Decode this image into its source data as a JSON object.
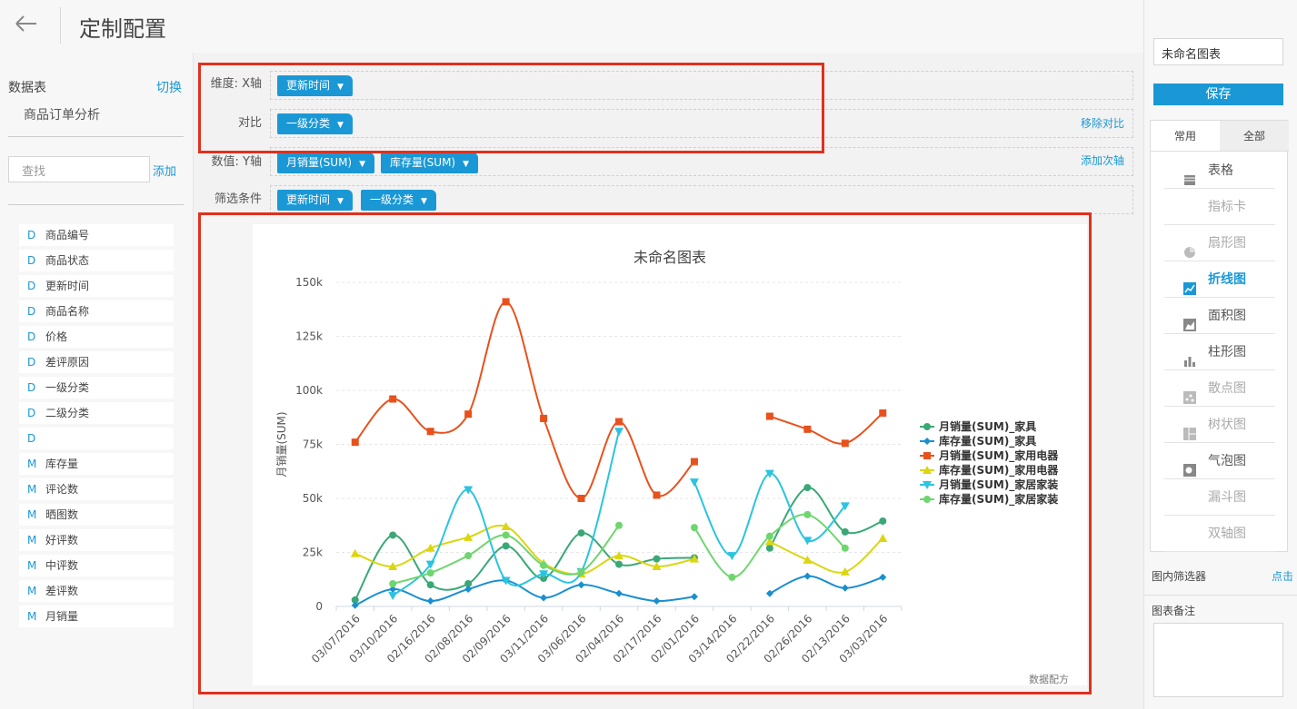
{
  "header": {
    "title": "定制配置",
    "back_icon": "arrow-left-icon"
  },
  "left": {
    "title": "数据表",
    "switch_label": "切换",
    "table_name": "商品订单分析",
    "search_placeholder": "查找",
    "add_label": "添加",
    "fields": [
      {
        "type": "D",
        "name": "商品编号"
      },
      {
        "type": "D",
        "name": "商品状态"
      },
      {
        "type": "D",
        "name": "更新时间"
      },
      {
        "type": "D",
        "name": "商品名称"
      },
      {
        "type": "D",
        "name": "价格"
      },
      {
        "type": "D",
        "name": "差评原因"
      },
      {
        "type": "D",
        "name": "一级分类"
      },
      {
        "type": "D",
        "name": "二级分类"
      },
      {
        "type": "D",
        "name": ""
      },
      {
        "type": "M",
        "name": "库存量"
      },
      {
        "type": "M",
        "name": "评论数"
      },
      {
        "type": "M",
        "name": "晒图数"
      },
      {
        "type": "M",
        "name": "好评数"
      },
      {
        "type": "M",
        "name": "中评数"
      },
      {
        "type": "M",
        "name": "差评数"
      },
      {
        "type": "M",
        "name": "月销量"
      }
    ]
  },
  "config": {
    "dimension_label": "维度: X轴",
    "dimension_chip": "更新时间",
    "compare_label": "对比",
    "compare_chip": "一级分类",
    "remove_compare": "移除对比",
    "value_label": "数值: Y轴",
    "value_chips": [
      "月销量(SUM)",
      "库存量(SUM)"
    ],
    "add_secondary_axis": "添加次轴",
    "filter_label": "筛选条件",
    "filter_chips": [
      "更新时间",
      "一级分类"
    ]
  },
  "chart_data": {
    "type": "line",
    "title": "未命名图表",
    "ylabel": "月销量(SUM)",
    "xlabel": "",
    "footer": "数据配方",
    "ylim": [
      0,
      150000
    ],
    "yticks": [
      0,
      25000,
      50000,
      75000,
      100000,
      125000,
      150000
    ],
    "ytick_labels": [
      "0",
      "25k",
      "50k",
      "75k",
      "100k",
      "125k",
      "150k"
    ],
    "categories": [
      "03/07/2016",
      "03/10/2016",
      "02/16/2016",
      "02/08/2016",
      "02/09/2016",
      "03/11/2016",
      "03/06/2016",
      "02/04/2016",
      "02/17/2016",
      "02/01/2016",
      "03/14/2016",
      "02/22/2016",
      "02/26/2016",
      "02/13/2016",
      "03/03/2016"
    ],
    "legend_position": "right",
    "series": [
      {
        "name": "月销量(SUM)_家具",
        "color": "#3aa876",
        "marker": "circle",
        "values": [
          3000,
          33000,
          10000,
          10500,
          28000,
          13000,
          34000,
          19500,
          22000,
          22500,
          null,
          27000,
          55000,
          34500,
          39500
        ]
      },
      {
        "name": "库存量(SUM)_家具",
        "color": "#1a8fd0",
        "marker": "diamond",
        "values": [
          500,
          8000,
          2500,
          8000,
          12000,
          4000,
          10000,
          6000,
          2500,
          4500,
          null,
          6000,
          14000,
          8500,
          13500
        ]
      },
      {
        "name": "月销量(SUM)_家用电器",
        "color": "#e8511c",
        "marker": "square",
        "values": [
          76000,
          96000,
          81000,
          89000,
          141000,
          87000,
          50000,
          85500,
          51500,
          67000,
          null,
          88000,
          82000,
          75500,
          89500
        ]
      },
      {
        "name": "库存量(SUM)_家用电器",
        "color": "#dbd60f",
        "marker": "triangle",
        "values": [
          24500,
          18500,
          27000,
          32000,
          37000,
          20000,
          15000,
          23500,
          18500,
          22000,
          null,
          30000,
          21500,
          16000,
          31500
        ]
      },
      {
        "name": "月销量(SUM)_家居家装",
        "color": "#2bc4e0",
        "marker": "triangle-down",
        "values": [
          null,
          5000,
          19500,
          54000,
          12000,
          15000,
          16000,
          81000,
          null,
          57500,
          23500,
          61500,
          30500,
          46500,
          null
        ]
      },
      {
        "name": "库存量(SUM)_家居家装",
        "color": "#6ed66e",
        "marker": "circle",
        "values": [
          null,
          10500,
          15500,
          23500,
          33000,
          19000,
          16000,
          37500,
          null,
          36500,
          13500,
          32500,
          42500,
          27000,
          null
        ]
      }
    ]
  },
  "right": {
    "chart_name": "未命名图表",
    "save_label": "保存",
    "tab_common": "常用",
    "tab_all": "全部",
    "chart_types": [
      {
        "label": "表格",
        "icon": "table-icon",
        "state": "normal"
      },
      {
        "label": "指标卡",
        "icon": "",
        "state": "disabled"
      },
      {
        "label": "扇形图",
        "icon": "pie-chart-icon",
        "state": "disabled"
      },
      {
        "label": "折线图",
        "icon": "line-chart-icon",
        "state": "selected"
      },
      {
        "label": "面积图",
        "icon": "area-chart-icon",
        "state": "normal"
      },
      {
        "label": "柱形图",
        "icon": "bar-chart-icon",
        "state": "normal"
      },
      {
        "label": "散点图",
        "icon": "scatter-chart-icon",
        "state": "disabled"
      },
      {
        "label": "树状图",
        "icon": "treemap-icon",
        "state": "disabled"
      },
      {
        "label": "气泡图",
        "icon": "bubble-chart-icon",
        "state": "normal"
      },
      {
        "label": "漏斗图",
        "icon": "",
        "state": "disabled"
      },
      {
        "label": "双轴图",
        "icon": "",
        "state": "disabled"
      }
    ],
    "filter_label": "图内筛选器",
    "filter_link": "点击",
    "note_label": "图表备注"
  },
  "colors": {
    "accent": "#1a98d6",
    "highlight_border": "#e0301e"
  }
}
